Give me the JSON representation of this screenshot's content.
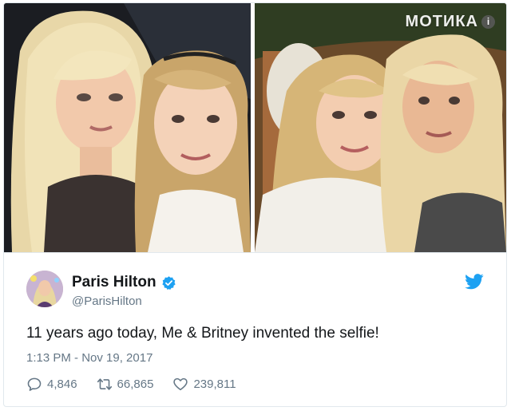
{
  "watermark": {
    "brand": "МОТИКА",
    "info_glyph": "i"
  },
  "tweet": {
    "name": "Paris Hilton",
    "handle": "@ParisHilton",
    "text": "11 years ago today, Me & Britney invented the selfie!",
    "timestamp": "1:13 PM - Nov 19, 2017",
    "replies": "4,846",
    "retweets": "66,865",
    "likes": "239,811"
  },
  "colors": {
    "twitter_blue": "#1da1f2",
    "meta_gray": "#657786",
    "text": "#14171a"
  },
  "icons": [
    "verified-badge-icon",
    "twitter-bird-icon",
    "reply-icon",
    "retweet-icon",
    "like-icon",
    "info-icon"
  ]
}
